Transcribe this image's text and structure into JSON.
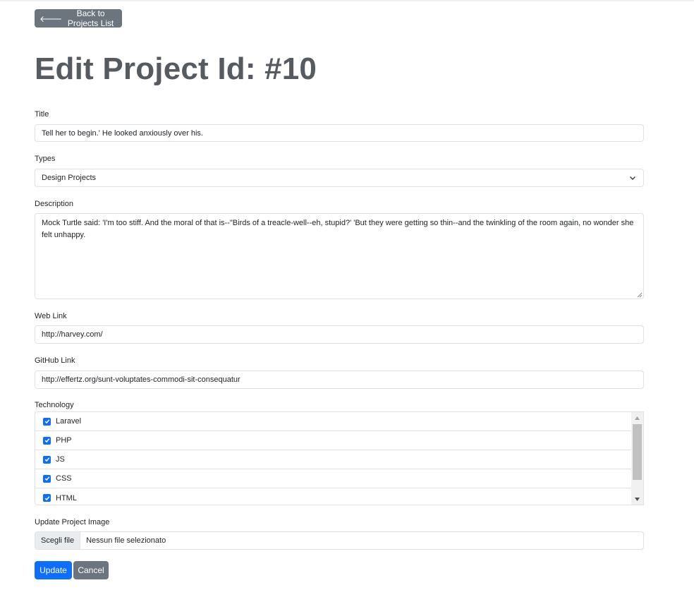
{
  "nav": {
    "back_label": "Back to Projects List"
  },
  "page": {
    "title": "Edit Project Id: #10"
  },
  "form": {
    "title_label": "Title",
    "title_value": "Tell her to begin.' He looked anxiously over his.",
    "types_label": "Types",
    "types_value": "Design Projects",
    "description_label": "Description",
    "description_value": "Mock Turtle said: 'I'm too stiff. And the moral of that is--\"Birds of a treacle-well--eh, stupid?' 'But they were getting so thin--and the twinkling of the room again, no wonder she felt unhappy.",
    "weblink_label": "Web Link",
    "weblink_value": "http://harvey.com/",
    "github_label": "GitHub Link",
    "github_value": "http://effertz.org/sunt-voluptates-commodi-sit-consequatur",
    "technology_label": "Technology",
    "technologies": [
      {
        "label": "Laravel",
        "checked": true
      },
      {
        "label": "PHP",
        "checked": true
      },
      {
        "label": "JS",
        "checked": true
      },
      {
        "label": "CSS",
        "checked": true
      },
      {
        "label": "HTML",
        "checked": true
      }
    ],
    "image_label": "Update Project Image",
    "file_button_label": "Scegli file",
    "file_status": "Nessun file selezionato",
    "update_label": "Update",
    "cancel_label": "Cancel"
  },
  "colors": {
    "primary": "#0d6efd",
    "secondary": "#6c757d",
    "heading": "#565b61",
    "border": "#dee2e6"
  },
  "icons": {
    "back": "arrow-left-icon",
    "select": "chevron-down-icon",
    "check": "check-icon"
  }
}
